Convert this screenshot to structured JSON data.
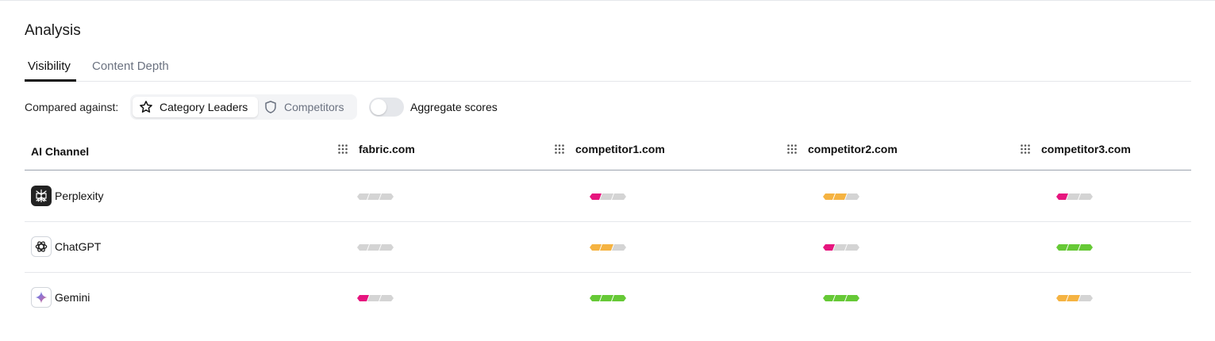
{
  "page": {
    "title": "Analysis"
  },
  "tabs": [
    {
      "label": "Visibility",
      "active": true
    },
    {
      "label": "Content Depth",
      "active": false
    }
  ],
  "filters": {
    "compared_label": "Compared against:",
    "options": [
      {
        "label": "Category Leaders",
        "icon": "star-icon",
        "selected": true
      },
      {
        "label": "Competitors",
        "icon": "shield-icon",
        "selected": false
      }
    ],
    "aggregate_label": "Aggregate scores",
    "aggregate_on": false
  },
  "table": {
    "channel_header": "AI Channel",
    "columns": [
      "fabric.com",
      "competitor1.com",
      "competitor2.com",
      "competitor3.com"
    ],
    "rows": [
      {
        "channel": "Perplexity",
        "icon": "perplexity-icon",
        "scores": [
          0,
          1,
          2,
          1
        ]
      },
      {
        "channel": "ChatGPT",
        "icon": "chatgpt-icon",
        "scores": [
          0,
          2,
          1,
          3
        ]
      },
      {
        "channel": "Gemini",
        "icon": "gemini-icon",
        "scores": [
          1,
          3,
          3,
          2
        ]
      }
    ],
    "score_max": 3
  },
  "colors": {
    "score_1": "#e6157e",
    "score_2": "#f5b342",
    "score_3": "#66c936",
    "empty": "#d4d4d4"
  }
}
